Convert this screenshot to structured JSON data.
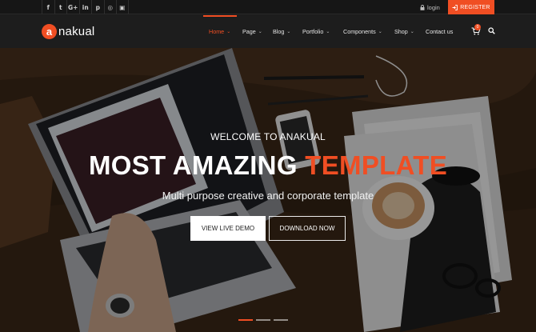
{
  "topbar": {
    "social": [
      {
        "icon": "facebook-icon",
        "glyph": "f"
      },
      {
        "icon": "twitter-icon",
        "glyph": "t"
      },
      {
        "icon": "google-plus-icon",
        "glyph": "G+"
      },
      {
        "icon": "linkedin-icon",
        "glyph": "in"
      },
      {
        "icon": "pinterest-icon",
        "glyph": "p"
      },
      {
        "icon": "dribbble-icon",
        "glyph": "◎"
      },
      {
        "icon": "instagram-icon",
        "glyph": "▣"
      }
    ],
    "login_label": "login",
    "register_label": "REGISTER"
  },
  "header": {
    "logo_letter": "a",
    "logo_text": "nakual",
    "nav": [
      {
        "label": "Home",
        "has_menu": true,
        "active": true
      },
      {
        "label": "Page",
        "has_menu": true,
        "active": false
      },
      {
        "label": "Blog",
        "has_menu": true,
        "active": false
      },
      {
        "label": "Portfolio",
        "has_menu": true,
        "active": false
      },
      {
        "label": "Components",
        "has_menu": true,
        "active": false
      },
      {
        "label": "Shop",
        "has_menu": true,
        "active": false
      },
      {
        "label": "Contact us",
        "has_menu": false,
        "active": false
      }
    ],
    "cart_count": "0"
  },
  "hero": {
    "welcome": "WELCOME TO ANAKUAL",
    "headline_main": "MOST AMAZING ",
    "headline_accent": "TEMPLATE",
    "subline": "Multi purpose creative and corporate template",
    "demo_button": "VIEW LIVE DEMO",
    "download_button": "DOWNLOAD NOW",
    "slides": 3,
    "active_slide": 1
  },
  "colors": {
    "accent": "#f04e23",
    "topbar_bg": "#161616",
    "header_bg": "#1d1d1d"
  }
}
